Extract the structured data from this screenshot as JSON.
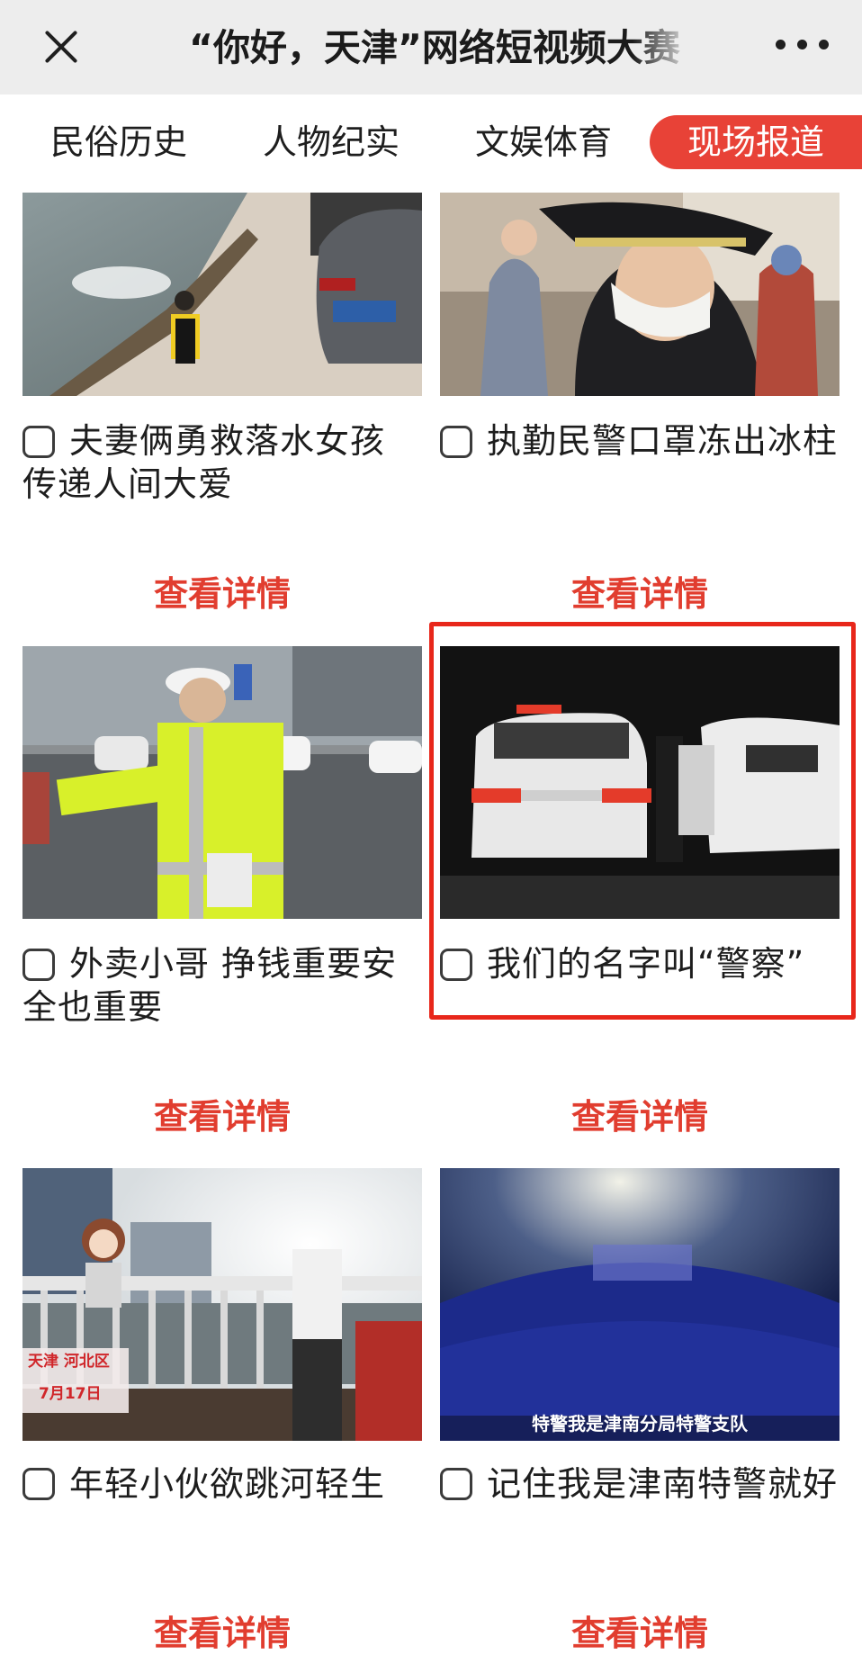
{
  "header": {
    "title": "“你好，天津”网络短视频大赛",
    "close_icon": "close-icon",
    "more_icon": "more-dots-icon"
  },
  "tabs": [
    {
      "label": "民俗历史",
      "active": false
    },
    {
      "label": "人物纪实",
      "active": false
    },
    {
      "label": "文娱体育",
      "active": false
    },
    {
      "label": "现场报道",
      "active": true
    }
  ],
  "cards": [
    {
      "title_line1": "夫妻俩勇救落水女孩",
      "title_line2": "传递人间大爱",
      "detail_label": "查看详情",
      "checked": false
    },
    {
      "title_line1": "执勤民警口罩冻出冰柱",
      "title_line2": "",
      "detail_label": "查看详情",
      "checked": false
    },
    {
      "title_line1": "外卖小哥 挣钱重要安",
      "title_line2": "全也重要",
      "detail_label": "查看详情",
      "checked": false
    },
    {
      "title_line1": "我们的名字叫“警察”",
      "title_line2": "",
      "detail_label": "查看详情",
      "checked": false,
      "highlighted": true
    },
    {
      "title_line1": "年轻小伙欲跳河轻生",
      "title_line2": "",
      "detail_label": "查看详情",
      "checked": false,
      "overlay_place": "天津 河北区",
      "overlay_date": "7月17日"
    },
    {
      "title_line1": "记住我是津南特警就好",
      "title_line2": "",
      "detail_label": "查看详情",
      "checked": false,
      "overlay_caption": "特警我是津南分局特警支队"
    }
  ],
  "colors": {
    "accent": "#e84237",
    "detail_text": "#e13d2f",
    "highlight_box": "#e8271b",
    "header_bg": "#ededed"
  }
}
